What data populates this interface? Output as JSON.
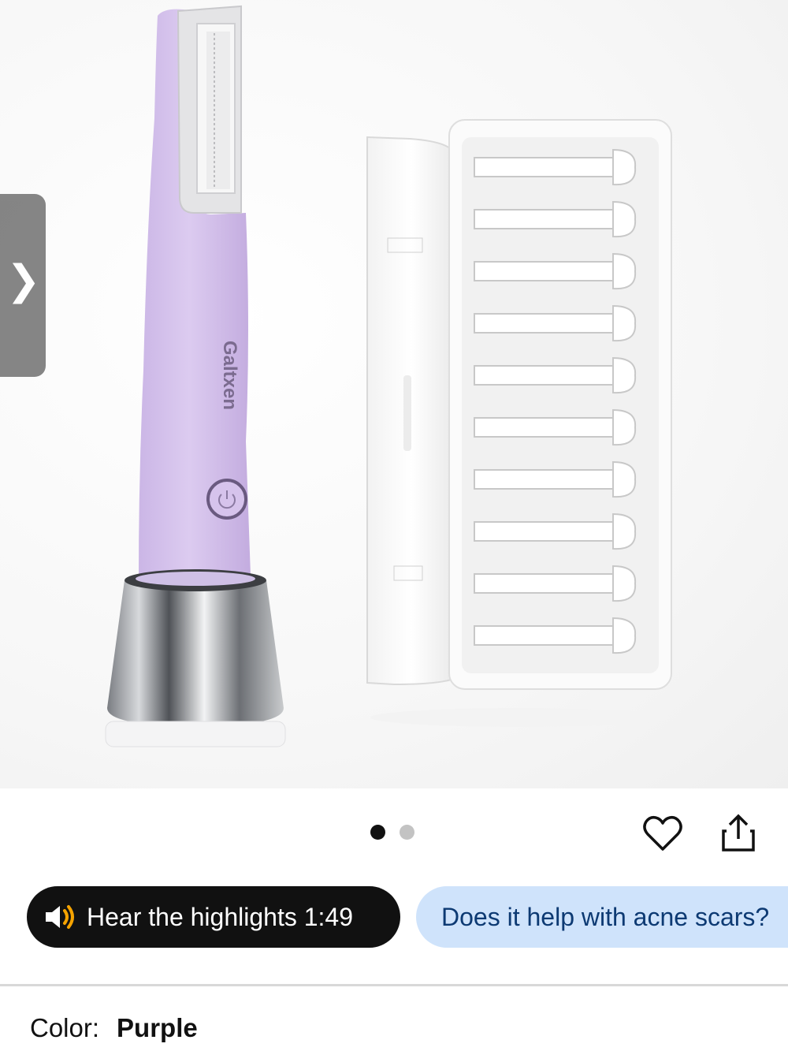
{
  "hero": {
    "brand_text": "Galtxen",
    "next_glyph": "❯"
  },
  "carousel": {
    "total": 2,
    "active": 1
  },
  "icons": {
    "wishlist": "heart-icon",
    "share": "share-icon",
    "audio": "speaker-icon"
  },
  "highlights_button": {
    "label": "Hear the highlights 1:49"
  },
  "question_chip": {
    "label": "Does it help with acne scars?"
  },
  "color": {
    "label": "Color:",
    "value": "Purple"
  },
  "colors": {
    "device_purple": "#d9c8ee",
    "dark_pill": "#111111",
    "blue_chip": "#cfe3fb",
    "blue_text": "#0d3a73",
    "audio_accent": "#f5a300"
  }
}
